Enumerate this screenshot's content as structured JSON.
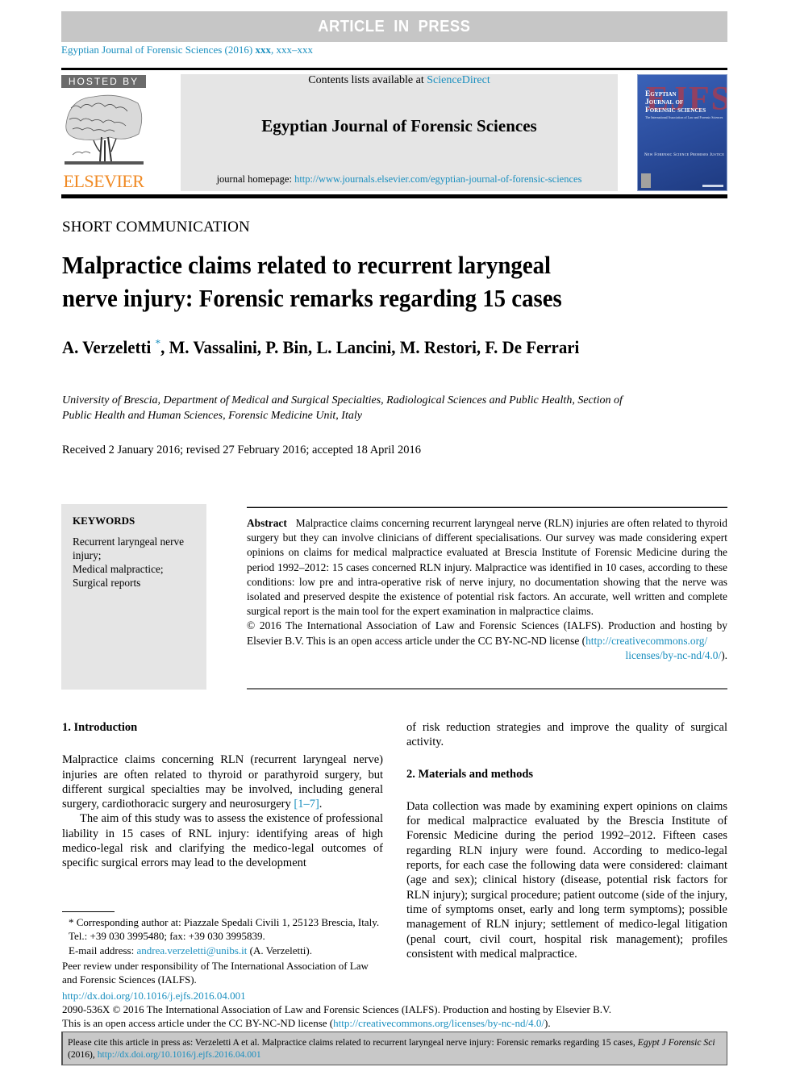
{
  "banner": {
    "label": "ARTICLE IN PRESS"
  },
  "journal_ref": {
    "journal": "Egyptian Journal of Forensic Sciences (2016) ",
    "volume": "xxx",
    "pages": ", xxx–xxx"
  },
  "header": {
    "hosted_by": "HOSTED BY",
    "publisher_logo_text": "ELSEVIER",
    "contents_prefix": "Contents lists available at ",
    "contents_link": "ScienceDirect",
    "journal_title": "Egyptian Journal of Forensic Sciences",
    "homepage_prefix": "journal homepage: ",
    "homepage_url": "http://www.journals.elsevier.com/egyptian-journal-of-forensic-sciences",
    "cover": {
      "big_letters": "EJFS",
      "line1": "Egyptian",
      "line2": "Journal of",
      "line3": "Forensic sciences",
      "subtitle": "The International Association of Law and Forensic Sciences",
      "tagline": "New Forensic Science Promises Justice"
    }
  },
  "article": {
    "type": "SHORT COMMUNICATION",
    "title_line1": "Malpractice claims related to recurrent laryngeal",
    "title_line2": "nerve injury: Forensic remarks regarding 15 cases",
    "first_author": "A. Verzeletti",
    "corresponding_mark": "*",
    "other_authors": ", M. Vassalini, P. Bin, L. Lancini, M. Restori, F. De Ferrari",
    "affiliation_line1": "University of Brescia, Department of Medical and Surgical Specialties, Radiological Sciences and Public Health, Section of",
    "affiliation_line2": "Public Health and Human Sciences, Forensic Medicine Unit, Italy",
    "received": "Received 2 January 2016; revised 27 February 2016; accepted 18 April 2016"
  },
  "keywords": {
    "heading": "KEYWORDS",
    "items": [
      "Recurrent laryngeal nerve injury;",
      "Medical malpractice;",
      "Surgical reports"
    ]
  },
  "abstract": {
    "label": "Abstract",
    "text": "Malpractice claims concerning recurrent laryngeal nerve (RLN) injuries are often related to thyroid surgery but they can involve clinicians of different specialisations. Our survey was made considering expert opinions on claims for medical malpractice evaluated at Brescia Institute of Forensic Medicine during the period 1992–2012: 15 cases concerned RLN injury. Malpractice was identified in 10 cases, according to these conditions: low pre and intra-operative risk of nerve injury, no documentation showing that the nerve was isolated and preserved despite the existence of potential risk factors. An accurate, well written and complete surgical report is the main tool for the expert examination in malpractice claims.",
    "copyright": "© 2016 The International Association of Law and Forensic Sciences (IALFS). Production and hosting by Elsevier B.V. This is an open access article under the CC BY-NC-ND license (",
    "license_link_part1": "http://creativecommons.org/",
    "license_link_part2": "licenses/by-nc-nd/4.0/",
    "license_close": ")."
  },
  "body": {
    "intro_heading": "1. Introduction",
    "intro_p1": "Malpractice claims concerning RLN (recurrent laryngeal nerve) injuries are often related to thyroid or parathyroid surgery, but different surgical specialties may be involved, including general surgery, cardiothoracic surgery and neurosurgery ",
    "intro_p1_ref": "[1–7]",
    "intro_p1_end": ".",
    "intro_p2": "The aim of this study was to assess the existence of professional liability in 15 cases of RNL injury: identifying areas of high medico-legal risk and clarifying the medico-legal outcomes of specific surgical errors may lead to the development",
    "intro_p2_cont": "of risk reduction strategies and improve the quality of surgical activity.",
    "methods_heading": "2. Materials and methods",
    "methods_p1": "Data collection was made by examining expert opinions on claims for medical malpractice evaluated by the Brescia Institute of Forensic Medicine during the period 1992–2012. Fifteen cases regarding RLN injury were found. According to medico-legal reports, for each case the following data were considered: claimant (age and sex); clinical history (disease, potential risk factors for RLN injury); surgical procedure; patient outcome (side of the injury, time of symptoms onset, early and long term symptoms); possible management of RLN injury; settlement of medico-legal litigation (penal court, civil court, hospital risk management); profiles consistent with medical malpractice."
  },
  "footnotes": {
    "corresponding": "* Corresponding author at: Piazzale Spedali Civili 1, 25123 Brescia, Italy. Tel.: +39 030 3995480; fax: +39 030 3995839.",
    "email_label": "E-mail address: ",
    "email": "andrea.verzeletti@unibs.it",
    "email_name": " (A. Verzeletti).",
    "peer_review": "Peer review under responsibility of The International Association of Law and Forensic Sciences (IALFS)."
  },
  "doi_block": {
    "doi_url": "http://dx.doi.org/10.1016/j.ejfs.2016.04.001",
    "issn_line": "2090-536X © 2016 The International Association of Law and Forensic Sciences (IALFS). Production and hosting by Elsevier B.V.",
    "license_prefix": "This is an open access article under the CC BY-NC-ND license (",
    "license_url": "http://creativecommons.org/licenses/by-nc-nd/4.0/",
    "license_suffix": ")."
  },
  "citation": {
    "prefix": "Please cite this article in press as: Verzeletti A et al. Malpractice claims related to recurrent laryngeal nerve injury: Forensic remarks regarding 15 cases, ",
    "journal_abbrev": "Egypt J Forensic Sci",
    "year": " (2016), ",
    "doi_url": "http://dx.doi.org/10.1016/j.ejfs.2016.04.001"
  },
  "colors": {
    "link": "#1a8fbf",
    "elsevier_orange": "#f08a24",
    "banner_gray": "#c6c6c6",
    "box_gray": "#e5e5e5"
  }
}
